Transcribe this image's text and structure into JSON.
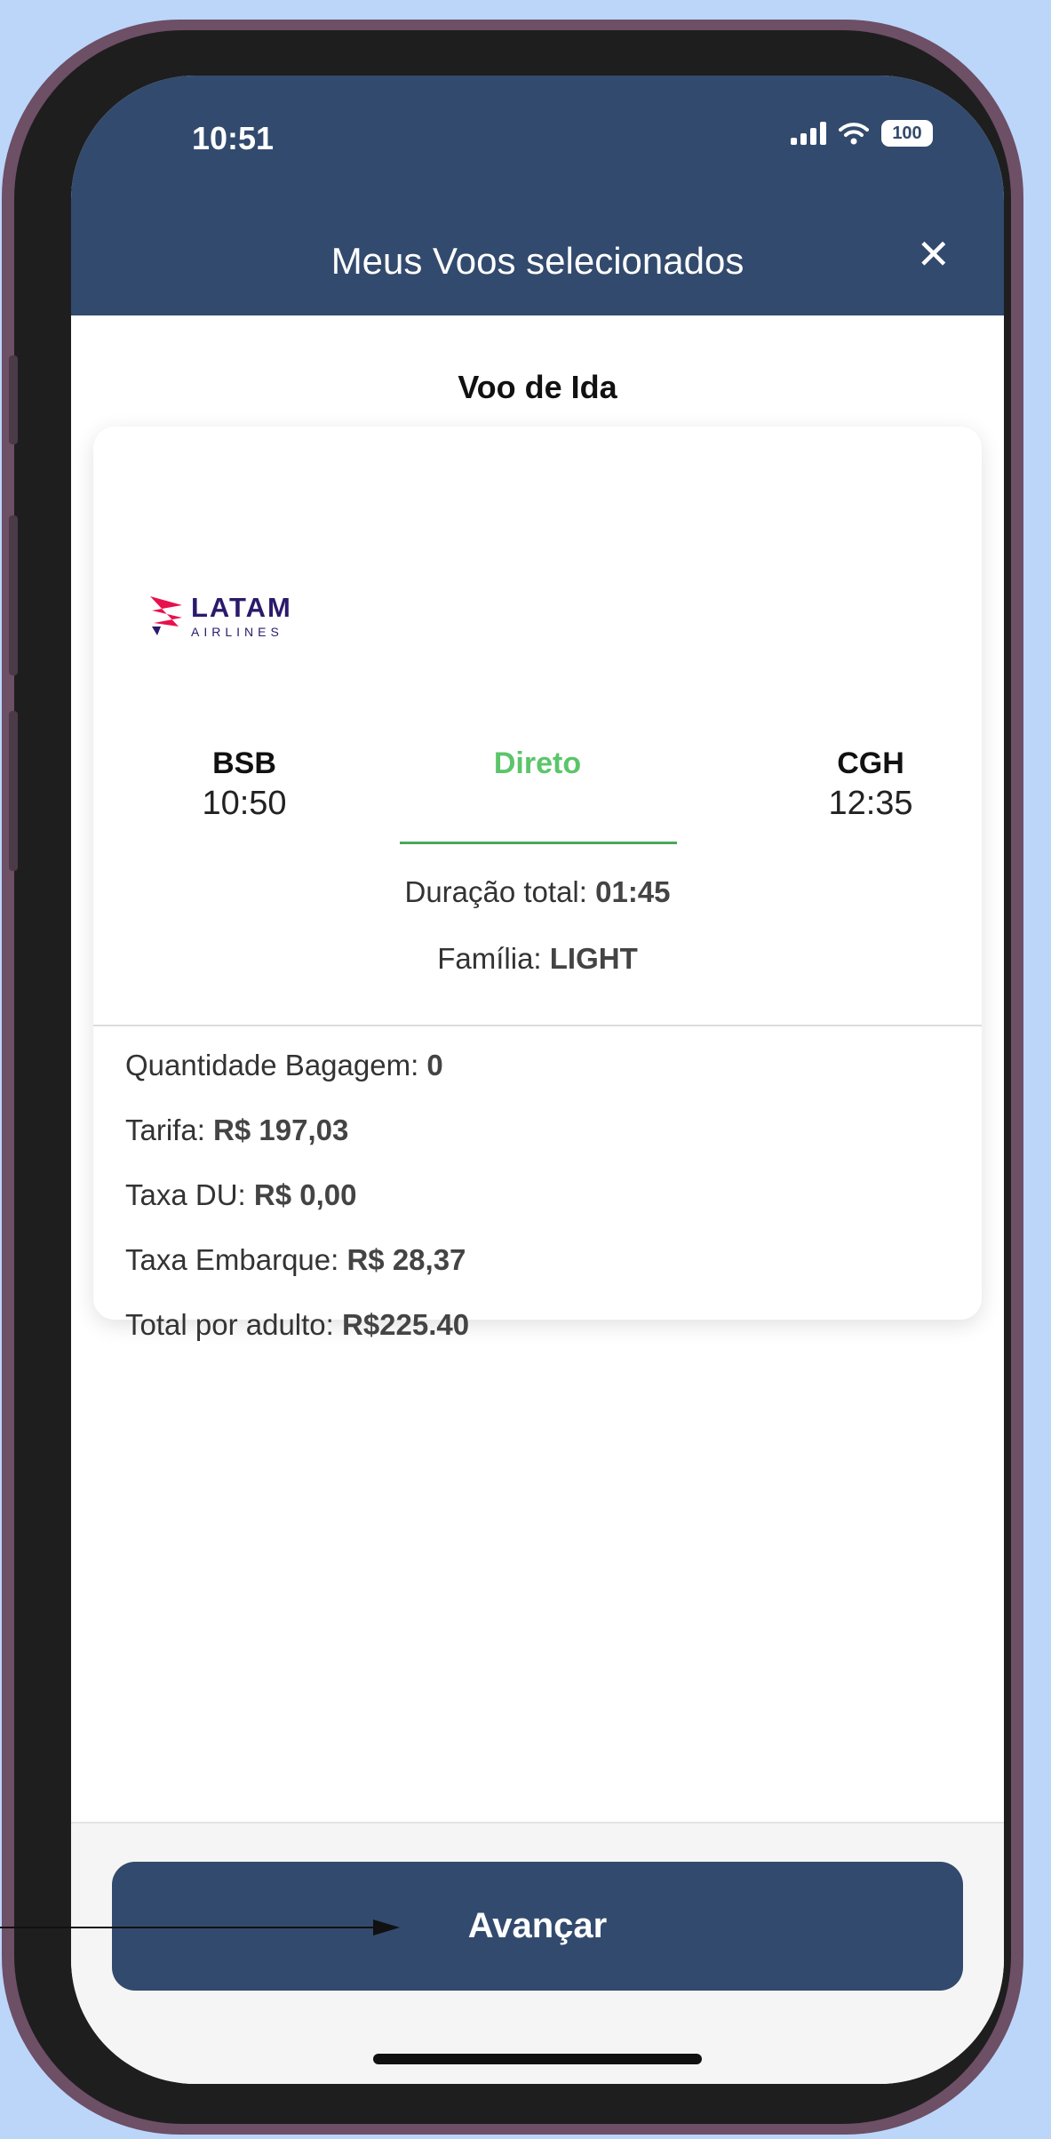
{
  "status_bar": {
    "time": "10:51",
    "battery": "100"
  },
  "header": {
    "title": "Meus Voos selecionados",
    "close": "✕"
  },
  "section": {
    "title": "Voo de Ida"
  },
  "airline": {
    "name": "LATAM",
    "sub": "AIRLINES"
  },
  "route": {
    "origin_code": "BSB",
    "origin_time": "10:50",
    "dest_code": "CGH",
    "dest_time": "12:35",
    "stops": "Direto"
  },
  "info": {
    "duration_label": "Duração total: ",
    "duration_value": "01:45",
    "family_label": "Família: ",
    "family_value": "LIGHT"
  },
  "fare": {
    "baggage_label": "Quantidade Bagagem: ",
    "baggage_value": "0",
    "tariff_label": "Tarifa: ",
    "tariff_value": "R$ 197,03",
    "du_label": "Taxa DU: ",
    "du_value": "R$ 0,00",
    "boarding_label": "Taxa Embarque: ",
    "boarding_value": "R$ 28,37",
    "total_label": "Total por adulto: ",
    "total_value": "R$225.40"
  },
  "footer": {
    "advance_label": "Avançar"
  },
  "colors": {
    "primary": "#324a6d",
    "direct": "#5cc56a",
    "background": "#bcd6fa"
  }
}
